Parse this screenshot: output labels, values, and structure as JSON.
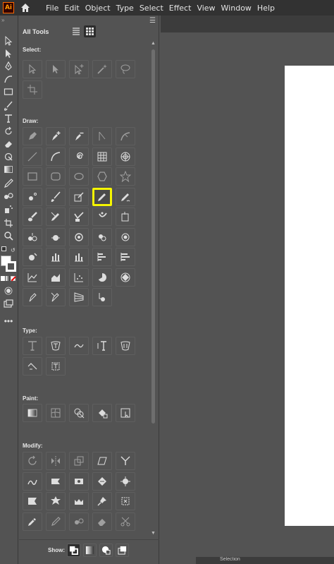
{
  "app": {
    "logo": "Ai",
    "home_icon": "home-icon"
  },
  "menu": [
    "File",
    "Edit",
    "Object",
    "Type",
    "Select",
    "Effect",
    "View",
    "Window",
    "Help"
  ],
  "panel": {
    "title": "All Tools",
    "sections": {
      "select": "Select:",
      "draw": "Draw:",
      "type": "Type:",
      "paint": "Paint:",
      "modify": "Modify:"
    },
    "show_label": "Show:",
    "highlighted_tool": "pencil-tool"
  },
  "status": {
    "label": "Selection"
  },
  "colors": {
    "highlight": "#f5f500",
    "panel_bg": "#535353",
    "menubar_bg": "#323232",
    "artboard": "#ffffff"
  }
}
